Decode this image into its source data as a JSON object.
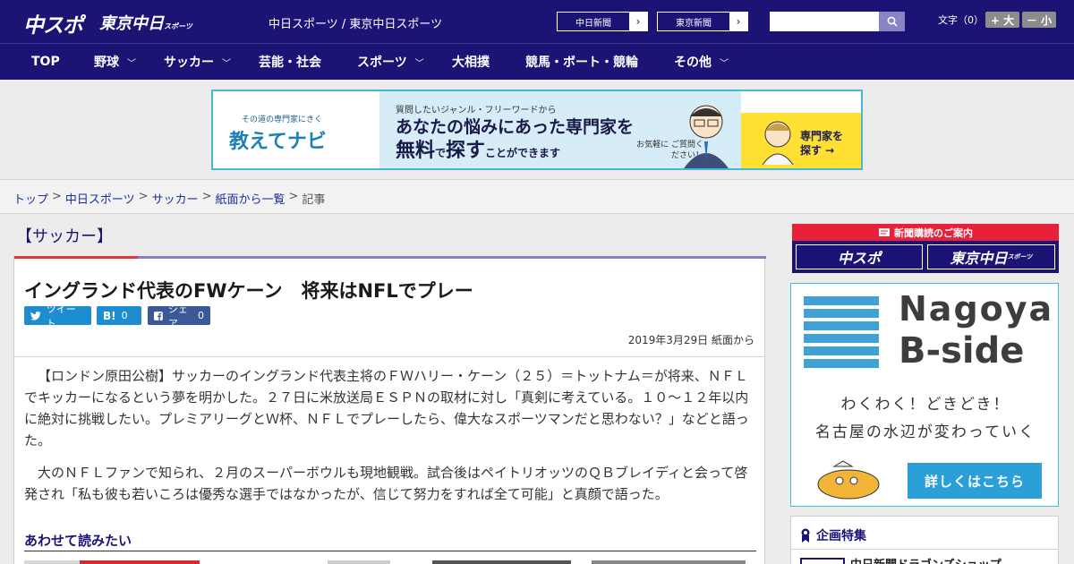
{
  "header": {
    "logo_chuspo": "中スポ",
    "logo_tokyo": "東京中日",
    "logo_tokyo_small": "スポーツ",
    "tagline": "中日スポーツ / 東京中日スポーツ",
    "site_links": [
      {
        "label": "中日新聞"
      },
      {
        "label": "東京新聞"
      }
    ],
    "search_placeholder": "",
    "font_label": "文字（0）",
    "font_larger": "+ 大",
    "font_smaller": "－ 小"
  },
  "nav": {
    "items": [
      {
        "label": "TOP",
        "has_menu": false
      },
      {
        "label": "野球",
        "has_menu": true
      },
      {
        "label": "サッカー",
        "has_menu": true
      },
      {
        "label": "芸能・社会",
        "has_menu": false
      },
      {
        "label": "スポーツ",
        "has_menu": true
      },
      {
        "label": "大相撲",
        "has_menu": false
      },
      {
        "label": "競馬・ボート・競輪",
        "has_menu": false
      },
      {
        "label": "その他",
        "has_menu": true
      }
    ]
  },
  "ad_banner": {
    "small": "その道の専門家にきく",
    "brand": "教えてナビ",
    "line1": "質問したいジャンル・フリーワードから",
    "line2": "あなたの悩みにあった専門家を",
    "line3_a": "無料",
    "line3_b": "で",
    "line3_c": "探す",
    "line3_d": "ことができます",
    "note": "お気軽に ご質問ください！",
    "cta": "専門家を 探す →"
  },
  "breadcrumb": {
    "items": [
      "トップ",
      "中日スポーツ",
      "サッカー",
      "紙面から一覧"
    ],
    "current": "記事",
    "separator": ">"
  },
  "article": {
    "category": "【サッカー】",
    "title": "イングランド代表のFWケーン　将来はNFLでプレー",
    "share": {
      "tweet": "ツイート",
      "hatena_label": "B!",
      "hatena_count": "0",
      "facebook_label": "シェア",
      "facebook_count": "0"
    },
    "date": "2019年3月29日 紙面から",
    "paragraphs": [
      "【ロンドン原田公樹】サッカーのイングランド代表主将のＦＷハリー・ケーン（２５）＝トットナム＝が将来、ＮＦＬでキッカーになるという夢を明かした。２７日に米放送局ＥＳＰＮの取材に対し「真剣に考えている。１０～１２年以内に絶対に挑戦したい。プレミアリーグとＷ杯、ＮＦＬでプレーしたら、偉大なスポーツマンだと思わない？」などと語った。",
      "大のＮＦＬファンで知られ、２月のスーパーボウルも現地観戦。試合後はペイトリオッツのＱＢブレイディと会って啓発され「私も彼も若いころは優秀な選手ではなかったが、信じて努力をすれば全て可能」と真顔で語った。"
    ],
    "related_heading": "あわせて読みたい"
  },
  "sidebar": {
    "subscribe_head": "新聞購読のご案内",
    "sub_logo_1": "中スポ",
    "sub_logo_2": "東京中日",
    "sub_logo_2_small": "スポーツ",
    "bside_title1": "Nagoya",
    "bside_title2": "B-side",
    "bside_line1": "わくわく！どきどき！",
    "bside_line2": "名古屋の水辺が変わっていく",
    "bside_button": "詳しくはこちら",
    "feature_head": "企画特集",
    "feature_item": "中日新聞ドラゴンズショップ"
  },
  "colors": {
    "header_bg": "#1c1475",
    "accent_red": "#e23a3a",
    "link": "#1c2d9e",
    "banner_border": "#46b6d9"
  }
}
